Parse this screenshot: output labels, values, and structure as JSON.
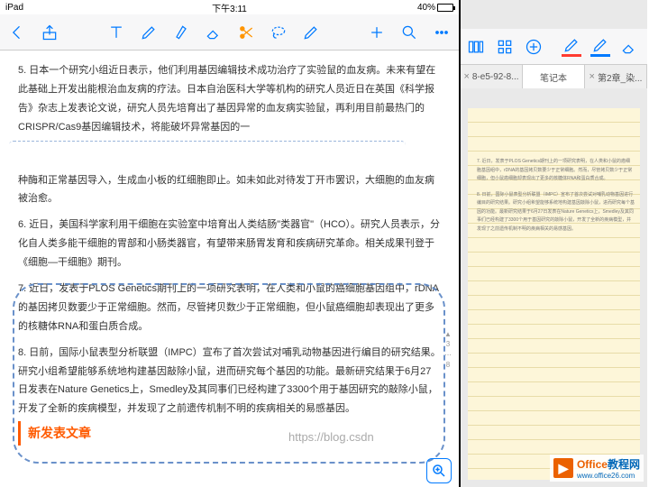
{
  "status": {
    "device": "iPad",
    "wifi": "᯾",
    "time": "下午3:11",
    "battery_pct": "40%"
  },
  "left_toolbar": {
    "back": "‹",
    "share": "",
    "text_tool": "T",
    "pen": "",
    "marker": "",
    "eraser": "",
    "scissors": "",
    "lasso": "",
    "pen2": "",
    "add": "+",
    "search": "",
    "more": "⋯"
  },
  "article": {
    "p5": "5. 日本一个研究小组近日表示，他们利用基因编辑技术成功治疗了实验鼠的血友病。未来有望在此基础上开发出能根治血友病的疗法。日本自治医科大学等机构的研究人员近日在英国《科学报告》杂志上发表论文说，研究人员先培育出了基因异常的血友病实验鼠，再利用目前最热门的CRISPR/Cas9基因编辑技术，将能破坏异常基因的一",
    "pbreak": "种酶和正常基因导入，生成血小板的红细胞即止。如未如此对待发丁开市罢识，大细胞的血友病被治愈。",
    "p6": "6. 近日，美国科学家利用干细胞在实验室中培育出人类结肠\"类器官\"（HCO）。研究人员表示，分化自人类多能干细胞的胃部和小肠类器官，有望带来肠胃发育和疾病研究革命。相关成果刊登于《细胞—干细胞》期刊。",
    "p7": "7. 近日，发表于PLOS Genetics期刊上的一项研究表明，在人类和小鼠的癌细胞基因组中，rDNA的基因拷贝数要少于正常细胞。然而，尽管拷贝数少于正常细胞，但小鼠癌细胞却表现出了更多的核糖体RNA和蛋白质合成。",
    "p8": "8. 日前，国际小鼠表型分析联盟（IMPC）宣布了首次尝试对哺乳动物基因进行编目的研究结果。研究小组希望能够系统地构建基因敲除小鼠，进而研究每个基因的功能。最新研究结果于6月27日发表在Nature Genetics上，Smedley及其同事们已经构建了3300个用于基因研究的敲除小鼠，开发了全新的疾病模型，并发现了之前遗传机制不明的疾病相关的易感基因。",
    "new_header": "新发表文章",
    "url_watermark": "https://blog.csdn",
    "page_indicator": {
      "up": "▲",
      "cur": "3",
      "sep": "⋯",
      "total": "8"
    }
  },
  "right": {
    "tabs": [
      {
        "label": "8-e5-92-8...",
        "close": "×"
      },
      {
        "label": "笔记本",
        "close": ""
      },
      {
        "label": "第2章_染...",
        "close": "×"
      }
    ],
    "note_p7": "7. 近日，发表于PLOS Genetics期刊上的一项研究表明，在人类和小鼠的癌细胞基因组中，rDNA的基因拷贝数要少于正常细胞。然而，尽管拷贝数少于正常细胞，但小鼠癌细胞却表现出了更多的核糖体RNA和蛋白质合成。",
    "note_p8": "8. 日前，国际小鼠表型分析联盟（IMPC）宣布了首次尝试对哺乳动物基因进行编目的研究结果。研究小组希望能够系统地构建基因敲除小鼠，进而研究每个基因的功能。最新研究结果于6月27日发表在Nature Genetics上，Smedley及其同事们已经构建了3300个用于基因研究的敲除小鼠，开发了全新的疾病模型，并发现了之前遗传机制不明的疾病相关的易感基因。"
  },
  "logo": {
    "brand": "Office",
    "suffix": "教程网",
    "url": "www.office26.com"
  }
}
